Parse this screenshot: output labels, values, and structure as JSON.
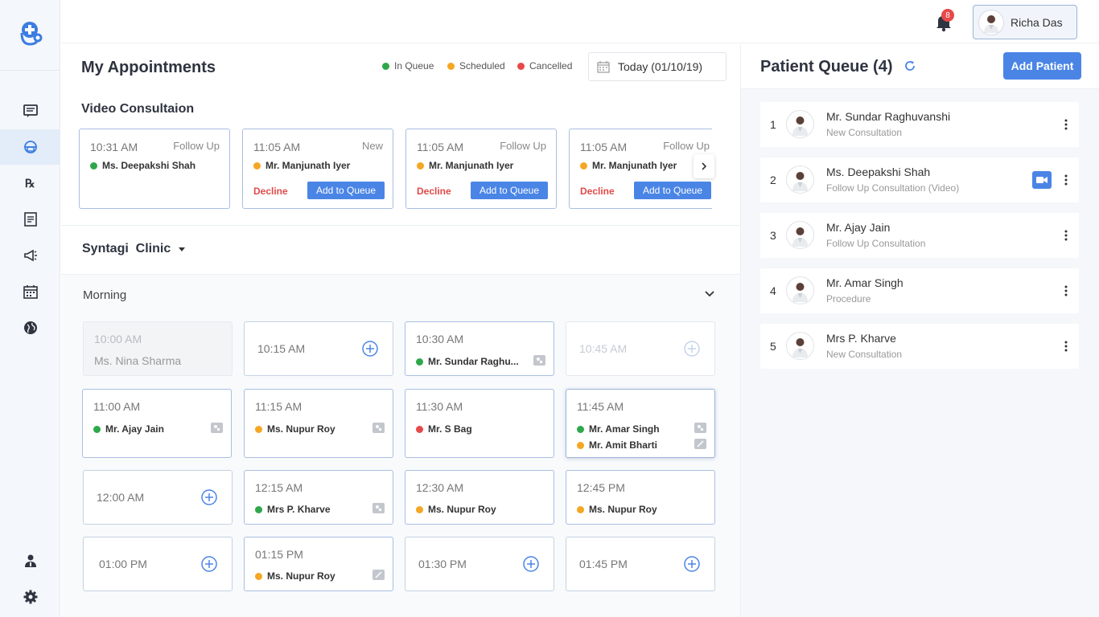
{
  "header": {
    "notifications_count": "8",
    "user_name": "Richa Das"
  },
  "sidebar": {
    "items": [
      {
        "icon": "message-icon"
      },
      {
        "icon": "helmet-icon",
        "active": true
      },
      {
        "icon": "prescription-icon"
      },
      {
        "icon": "records-icon"
      },
      {
        "icon": "megaphone-icon"
      },
      {
        "icon": "calendar-icon"
      },
      {
        "icon": "globe-icon"
      },
      {
        "icon": "doctor-icon"
      },
      {
        "icon": "gear-icon"
      }
    ]
  },
  "main": {
    "title": "My Appointments",
    "legend": {
      "in_queue": "In Queue",
      "scheduled": "Scheduled",
      "cancelled": "Cancelled"
    },
    "date": "Today (01/10/19)",
    "video_section_title": "Video Consultaion",
    "video_cards": [
      {
        "time": "10:31 AM",
        "type": "Follow Up",
        "patient": "Ms. Deepakshi Shah",
        "status": "green",
        "actions": false
      },
      {
        "time": "11:05 AM",
        "type": "New",
        "patient": "Mr. Manjunath Iyer",
        "status": "orange",
        "actions": true
      },
      {
        "time": "11:05 AM",
        "type": "Follow Up",
        "patient": "Mr. Manjunath Iyer",
        "status": "orange",
        "actions": true
      },
      {
        "time": "11:05 AM",
        "type": "Follow Up",
        "patient": "Mr. Manjunath Iyer",
        "status": "orange",
        "actions": true
      }
    ],
    "decline_label": "Decline",
    "add_to_queue_label": "Add to Queue",
    "clinic_name": "Syntagi  Clinic",
    "session_title": "Morning",
    "slots": [
      {
        "time": "10:00 AM",
        "patient": "Ms. Nina Sharma"
      },
      {
        "time": "10:15 AM"
      },
      {
        "time": "10:30 AM",
        "patient": "Mr. Sundar Raghu..."
      },
      {
        "time": "10:45 AM"
      },
      {
        "time": "11:00 AM",
        "patient": "Mr. Ajay Jain"
      },
      {
        "time": "11:15 AM",
        "patient": "Ms. Nupur Roy"
      },
      {
        "time": "11:30 AM",
        "patient": "Mr. S Bag"
      },
      {
        "time": "11:45 AM",
        "patient": "Mr. Amar Singh",
        "patient2": "Mr. Amit Bharti"
      },
      {
        "time": "12:00 AM"
      },
      {
        "time": "12:15 AM",
        "patient": "Mrs P. Kharve"
      },
      {
        "time": "12:30 AM",
        "patient": "Ms. Nupur Roy"
      },
      {
        "time": "12:45 PM",
        "patient": "Ms. Nupur Roy"
      },
      {
        "time": "01:00 PM"
      },
      {
        "time": "01:15 PM",
        "patient": "Ms. Nupur Roy"
      },
      {
        "time": "01:30 PM"
      },
      {
        "time": "01:45 PM"
      }
    ]
  },
  "queue": {
    "title": "Patient Queue (4)",
    "add_button": "Add Patient",
    "items": [
      {
        "num": "1",
        "name": "Mr. Sundar Raghuvanshi",
        "sub": "New Consultation"
      },
      {
        "num": "2",
        "name": "Ms. Deepakshi Shah",
        "sub": "Follow Up Consultation (Video)",
        "video": true
      },
      {
        "num": "3",
        "name": "Mr. Ajay Jain",
        "sub": "Follow Up Consultation"
      },
      {
        "num": "4",
        "name": "Mr. Amar Singh",
        "sub": "Procedure"
      },
      {
        "num": "5",
        "name": "Mrs P. Kharve",
        "sub": "New Consultation"
      }
    ]
  },
  "colors": {
    "accent": "#4a85e6",
    "in_queue": "#2ea84a",
    "scheduled": "#f5a623",
    "cancelled": "#e84848"
  }
}
